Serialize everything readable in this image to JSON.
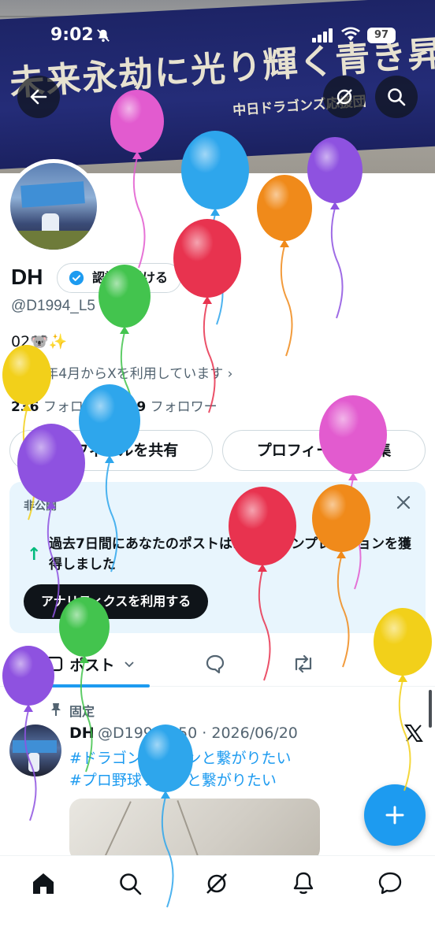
{
  "status_bar": {
    "time": "9:02",
    "battery": "97"
  },
  "banner": {
    "text": "未来永劫に光り輝く青き昇竜魂",
    "sub_text": "中日ドラゴンズ応援団"
  },
  "profile": {
    "name": "DH",
    "verify_label": "認証を受ける",
    "handle": "@D1994_L5",
    "bio": "02🐨✨",
    "joined": "2024年4月からXを利用しています",
    "following_count": "236",
    "following_label": "フォロー中",
    "followers_count": "19",
    "followers_label": "フォロワー",
    "share_button": "プロフィールを共有",
    "edit_button": "プロフィールを編集"
  },
  "analytics_card": {
    "label": "非公開",
    "text": "過去7日間にあなたのポストは10件のインプレッションを獲得しました",
    "button": "アナリティクスを利用する"
  },
  "tabs": {
    "posts": "ポスト"
  },
  "pinned_post": {
    "pinned_label": "固定",
    "author": "DH",
    "meta": "@D1994_L50 · 2026/06/20",
    "hashtags": [
      "#ドラゴンズファンと繋がりたい",
      "#プロ野球ファンと繋がりたい"
    ]
  },
  "icons": {
    "back": "back-arrow-icon",
    "grok": "grok-icon",
    "search": "search-icon",
    "home": "home-icon",
    "notifications": "bell-icon",
    "messages": "message-icon",
    "compose": "plus-icon"
  },
  "colors": {
    "accent": "#1d9bf0",
    "text": "#0f1419",
    "muted": "#536471"
  }
}
